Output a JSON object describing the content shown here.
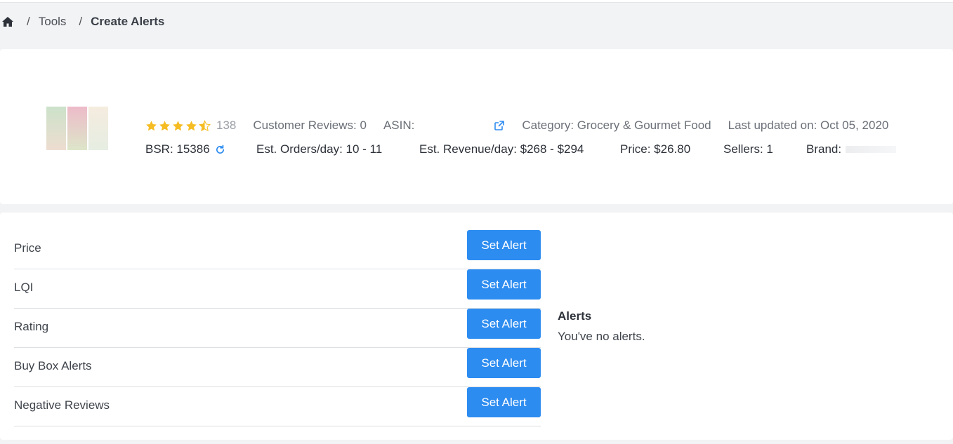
{
  "breadcrumb": {
    "home_icon": "home-icon",
    "items": [
      "Tools",
      "Create Alerts"
    ],
    "separator": "/"
  },
  "product": {
    "rating_stars": 4.5,
    "rating_count": "138",
    "customer_reviews": "Customer Reviews: 0",
    "asin": "ASIN:",
    "category": "Category: Grocery & Gourmet Food",
    "last_updated": "Last updated on: Oct 05, 2020",
    "bsr": "BSR: 15386",
    "orders_per_day": "Est. Orders/day: 10 - 11",
    "revenue_per_day": "Est. Revenue/day: $268 - $294",
    "price": "Price: $26.80",
    "sellers": "Sellers: 1",
    "brand": "Brand:",
    "star_color": "#f5bd23",
    "link_color": "#2d8cf0"
  },
  "alerts": {
    "rows": [
      {
        "label": "Price",
        "button": "Set Alert"
      },
      {
        "label": "LQI",
        "button": "Set Alert"
      },
      {
        "label": "Rating",
        "button": "Set Alert"
      },
      {
        "label": "Buy Box Alerts",
        "button": "Set Alert"
      },
      {
        "label": "Negative Reviews",
        "button": "Set Alert"
      }
    ],
    "panel_title": "Alerts",
    "empty_message": "You've no alerts.",
    "button_color": "#2d8cf0"
  }
}
